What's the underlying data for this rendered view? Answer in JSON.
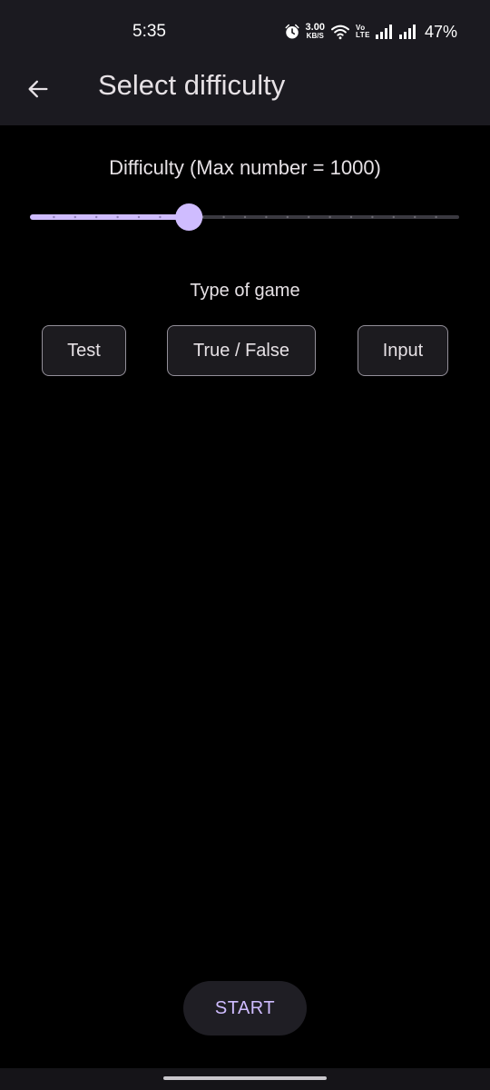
{
  "status_bar": {
    "time": "5:35",
    "net_speed_value": "3.00",
    "net_speed_unit": "KB/S",
    "volte_top": "Vo",
    "volte_bottom": "LTE",
    "battery": "47%",
    "icons": [
      "alarm-icon",
      "wifi-icon",
      "signal-icon",
      "signal-icon"
    ]
  },
  "app_bar": {
    "title": "Select difficulty",
    "back_icon": "arrow-back-icon"
  },
  "difficulty": {
    "label": "Difficulty (Max number = 1000)",
    "slider_value_fraction": 0.368,
    "slider_steps": 20
  },
  "game_type": {
    "label": "Type of game",
    "options": [
      "Test",
      "True / False",
      "Input"
    ]
  },
  "start_label": "START",
  "colors": {
    "background": "#000000",
    "bar": "#1b1a20",
    "accent": "#cfbcff",
    "inactive_track": "#3a3940",
    "button_border": "#938f99"
  }
}
